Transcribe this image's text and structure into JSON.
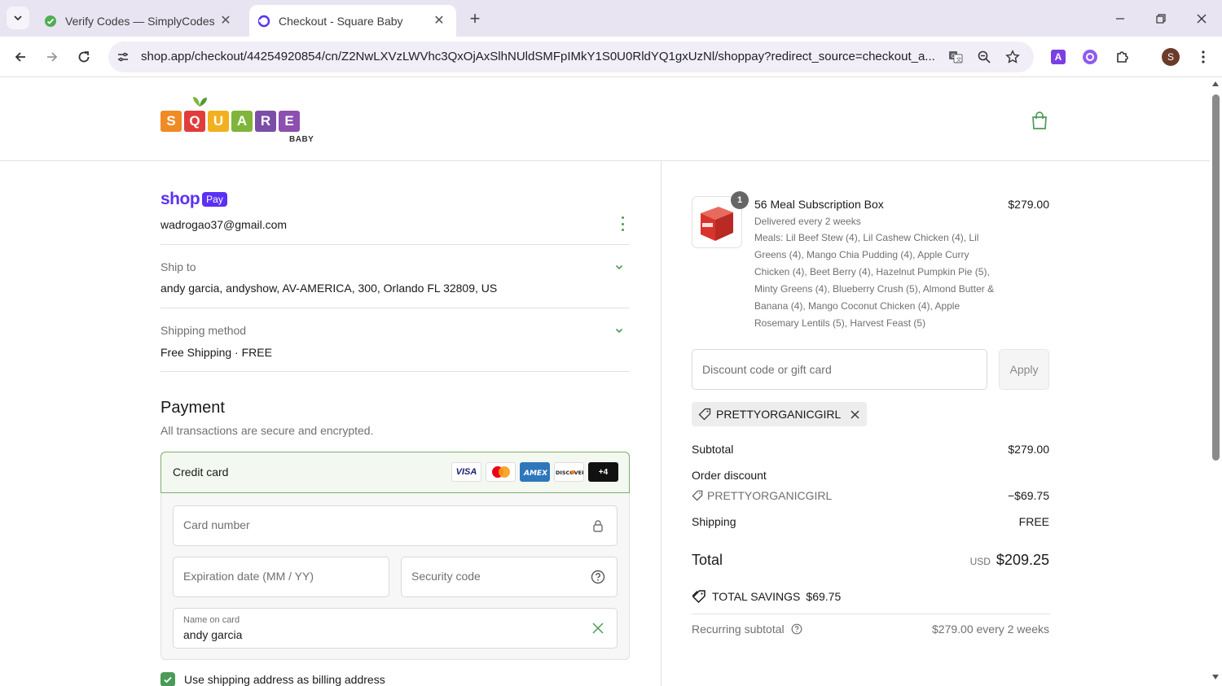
{
  "browser": {
    "tabs": [
      {
        "title": "Verify Codes — SimplyCodes",
        "active": false
      },
      {
        "title": "Checkout - Square Baby",
        "active": true
      }
    ],
    "url": "shop.app/checkout/44254920854/cn/Z2NwLXVzLWVhc3QxOjAxSlhNUldSMFpIMkY1S0U0RldYQ1gxUzNl/shoppay?redirect_source=checkout_a...",
    "profile_initial": "S",
    "extension_a_label": "A"
  },
  "header": {
    "logo_letters": [
      {
        "ch": "S",
        "color": "#f08a24"
      },
      {
        "ch": "Q",
        "color": "#e23b3b"
      },
      {
        "ch": "U",
        "color": "#f2b01e"
      },
      {
        "ch": "A",
        "color": "#7fb53a"
      },
      {
        "ch": "R",
        "color": "#7b4ea6"
      },
      {
        "ch": "E",
        "color": "#8d4fb0"
      }
    ],
    "logo_sub": "BABY"
  },
  "checkout": {
    "shoppay_word": "shop",
    "shoppay_badge": "Pay",
    "email": "wadrogao37@gmail.com",
    "ship_to_label": "Ship to",
    "ship_to_value": "andy garcia, andyshow, AV-AMERICA, 300, Orlando FL 32809, US",
    "shipping_method_label": "Shipping method",
    "shipping_method_value": "Free Shipping · FREE",
    "payment_title": "Payment",
    "payment_sub": "All transactions are secure and encrypted.",
    "credit_card_label": "Credit card",
    "card_brands": [
      "VISA",
      "MC",
      "AMEX",
      "DISCOVER",
      "+4"
    ],
    "card_number_placeholder": "Card number",
    "expiration_placeholder": "Expiration date (MM / YY)",
    "security_placeholder": "Security code",
    "name_on_card_label": "Name on card",
    "name_on_card_value": "andy garcia",
    "billing_same_label": "Use shipping address as billing address"
  },
  "summary": {
    "quantity": "1",
    "product_name": "56 Meal Subscription Box",
    "product_price": "$279.00",
    "product_frequency": "Delivered every 2 weeks",
    "product_meals": "Meals: Lil Beef Stew (4), Lil Cashew Chicken (4), Lil Greens (4), Mango Chia Pudding (4), Apple Curry Chicken (4), Beet Berry (4), Hazelnut Pumpkin Pie (5), Minty Greens (4), Blueberry Crush (5), Almond Butter & Banana (4), Mango Coconut Chicken (4), Apple Rosemary Lentils (5), Harvest Feast (5)",
    "discount_placeholder": "Discount code or gift card",
    "apply_label": "Apply",
    "applied_code": "PRETTYORGANICGIRL",
    "subtotal_label": "Subtotal",
    "subtotal_value": "$279.00",
    "order_discount_label": "Order discount",
    "order_discount_code": "PRETTYORGANICGIRL",
    "order_discount_value": "−$69.75",
    "shipping_label": "Shipping",
    "shipping_value": "FREE",
    "total_label": "Total",
    "total_currency": "USD",
    "total_value": "$209.25",
    "savings_label": "TOTAL SAVINGS",
    "savings_value": "$69.75",
    "recurring_label": "Recurring subtotal",
    "recurring_value": "$279.00 every 2 weeks"
  },
  "colors": {
    "accent_green": "#4a9b58",
    "shop_purple": "#5a31f4",
    "chrome_bg": "#e9e4f2"
  }
}
